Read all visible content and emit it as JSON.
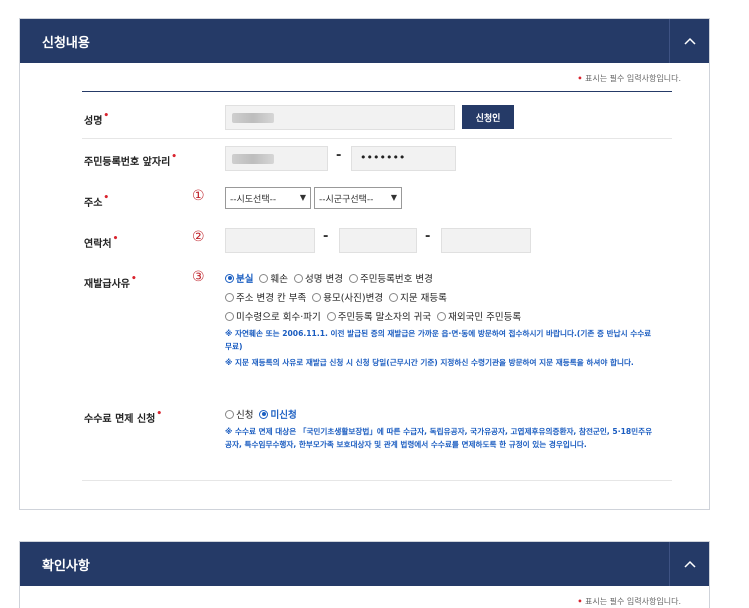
{
  "section1": {
    "title": "신청내용",
    "toggle_icon": "chevron-up-icon",
    "required_note": "표시는 필수 입력사항입니다.",
    "required_dot": "•",
    "fields": {
      "name": {
        "label": "성명",
        "button": "신청인"
      },
      "rrn": {
        "label": "주민등록번호 앞자리",
        "dash": "-",
        "masked": "•••••••"
      },
      "address": {
        "label": "주소",
        "num": "①",
        "sido": "--시도선택--",
        "sigungu": "--시군구선택--"
      },
      "contact": {
        "label": "연락처",
        "num": "②",
        "dash": "-"
      },
      "reason": {
        "label": "재발급사유",
        "num": "③",
        "options_row1": [
          "분실",
          "훼손",
          "성명 변경",
          "주민등록번호 변경"
        ],
        "options_row2": [
          "주소 변경 칸 부족",
          "용모(사진)변경",
          "지문 재등록"
        ],
        "options_row3": [
          "미수령으로 회수·파기",
          "주민등록 말소자의 귀국",
          "재외국민 주민등록"
        ],
        "selected": "분실",
        "notice1": "※ 자연훼손 또는 2006.11.1. 이전 발급된 증의 재발급은 가까운 읍·면·동에 방문하여 접수하시기 바랍니다.(기존 증 반납시 수수료 무료)",
        "notice2": "※ 지문 재등록의 사유로 재발급 신청 시 신청 당일(근무시간 기준) 지정하신 수령기관을 방문하여 지문 재등록을 하셔야 합니다."
      },
      "fee": {
        "label": "수수료 면제 신청",
        "options": [
          "신청",
          "미신청"
        ],
        "selected": "미신청",
        "notice": "※ 수수료 면제 대상은 「국민기초생활보장법」에 따른 수급자, 독립유공자, 국가유공자, 고엽제후유의증환자, 참전군인, 5·18민주유공자, 특수임무수행자, 한부모가족 보호대상자 및 관계 법령에서 수수료를 면제하도록 한 규정이 있는 경우입니다."
      }
    }
  },
  "section2": {
    "title": "확인사항",
    "toggle_icon": "chevron-up-icon",
    "required_note": "표시는 필수 입력사항입니다."
  }
}
